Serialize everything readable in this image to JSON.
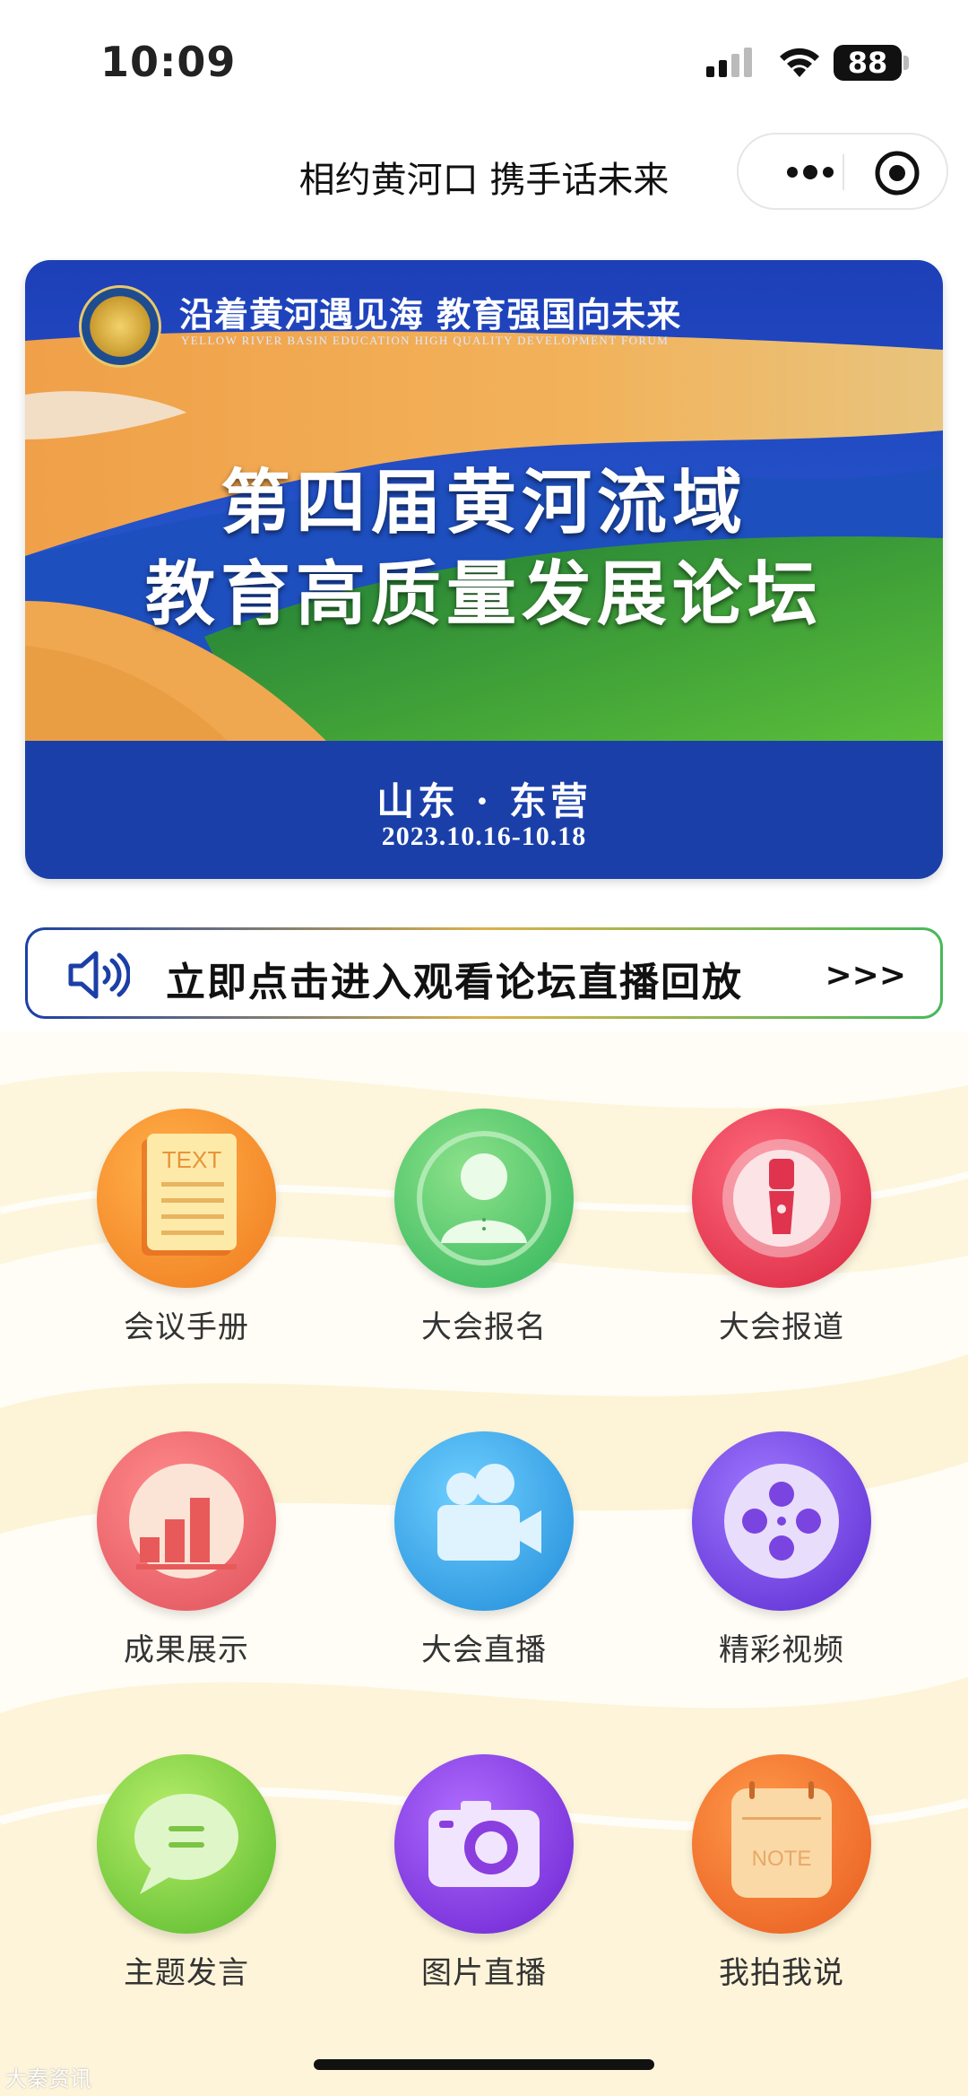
{
  "status_bar": {
    "time": "10:09",
    "battery": "88"
  },
  "nav": {
    "title": "相约黄河口 携手话未来"
  },
  "banner": {
    "slogan": "沿着黄河遇见海  教育强国向未来",
    "slogan_en": "YELLOW RIVER BASIN EDUCATION HIGH QUALITY DEVELOPMENT FORUM",
    "title_line1": "第四届黄河流域",
    "title_line2": "教育高质量发展论坛",
    "location": "山东 · 东营",
    "date": "2023.10.16-10.18"
  },
  "live_button": {
    "label": "立即点击进入观看论坛直播回放",
    "arrows": ">>>"
  },
  "menu": [
    {
      "label": "会议手册",
      "icon": "document-text-icon",
      "color": "#f08a2a"
    },
    {
      "label": "大会报名",
      "icon": "person-icon",
      "color": "#4fcf6a"
    },
    {
      "label": "大会报道",
      "icon": "microphone-icon",
      "color": "#e03a52"
    },
    {
      "label": "成果展示",
      "icon": "bar-chart-icon",
      "color": "#ef6b6b"
    },
    {
      "label": "大会直播",
      "icon": "video-camera-icon",
      "color": "#2fa6e6"
    },
    {
      "label": "精彩视频",
      "icon": "film-reel-icon",
      "color": "#7b4de0"
    },
    {
      "label": "主题发言",
      "icon": "chat-bubble-icon",
      "color": "#7ed23a"
    },
    {
      "label": "图片直播",
      "icon": "camera-icon",
      "color": "#8e3fe0"
    },
    {
      "label": "我拍我说",
      "icon": "note-icon",
      "color": "#f0702a"
    }
  ],
  "watermark": "大秦资讯"
}
